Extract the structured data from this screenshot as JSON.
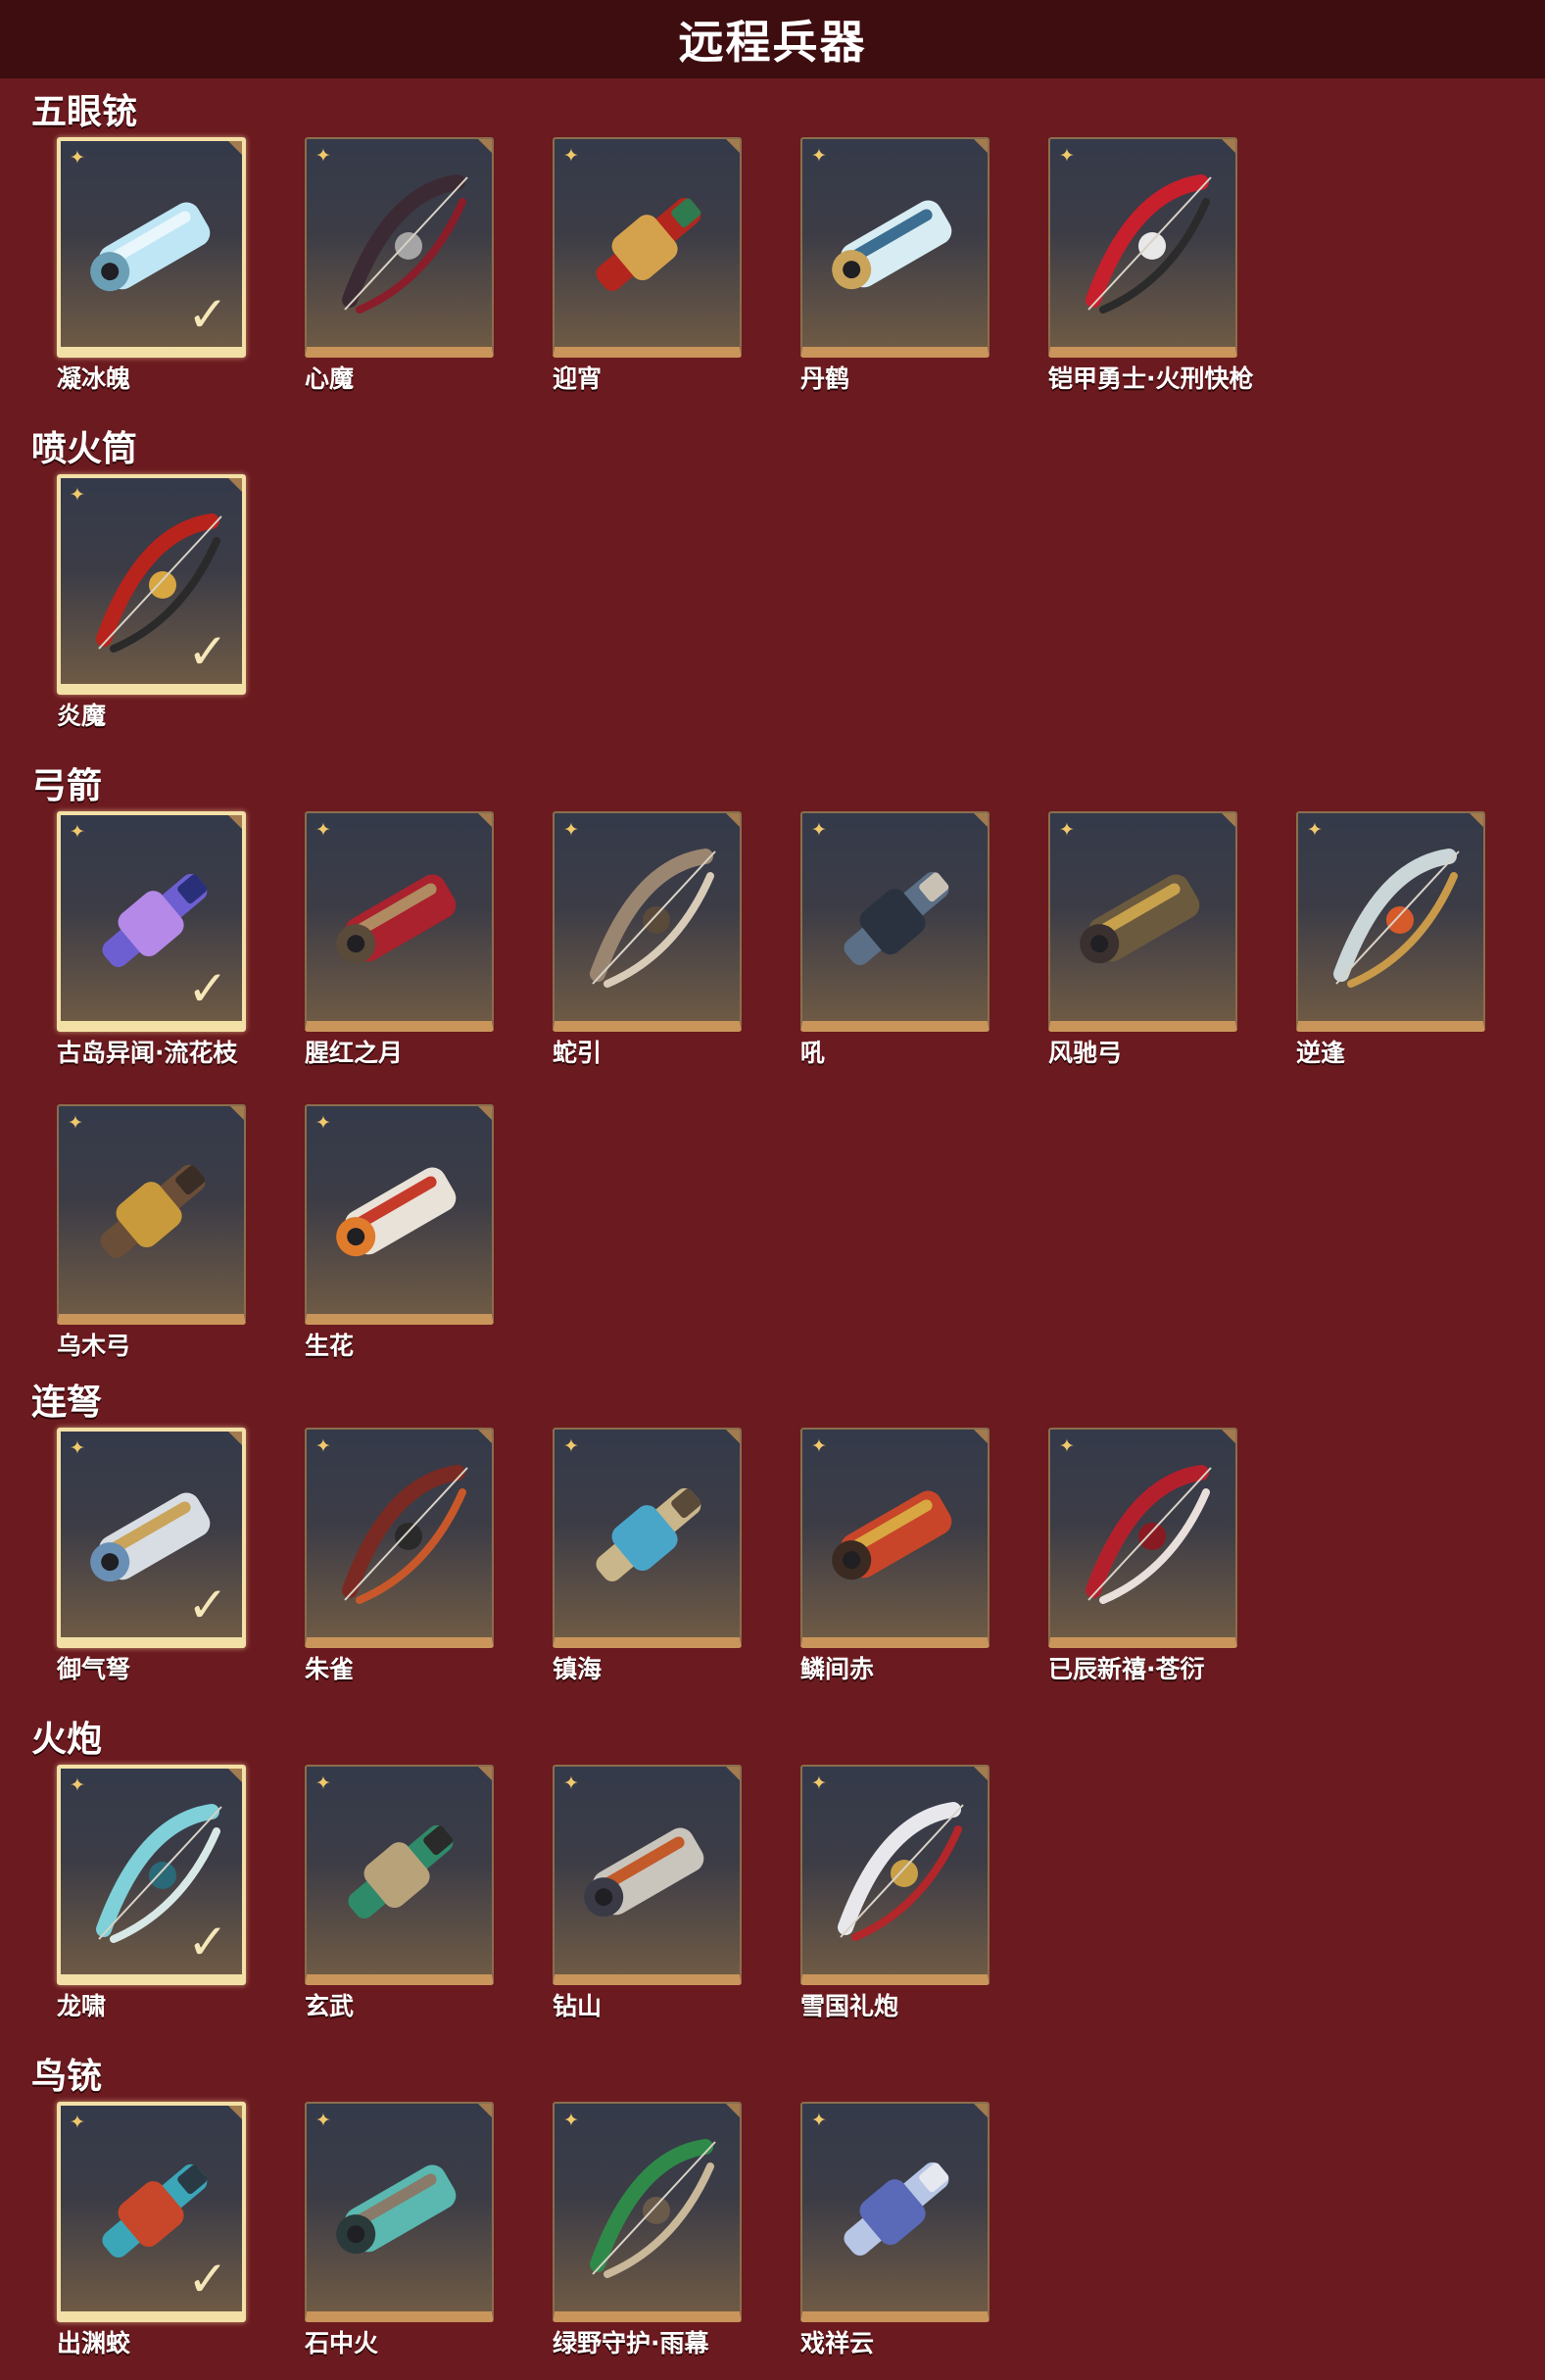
{
  "page_title": "远程兵器",
  "sections": [
    {
      "title": "五眼铳",
      "items": [
        {
          "name": "凝冰魄",
          "selected": true,
          "icon": "ice-five-barrel-gun-icon"
        },
        {
          "name": "心魔",
          "selected": false,
          "icon": "dark-demon-gun-icon"
        },
        {
          "name": "迎宵",
          "selected": false,
          "icon": "red-lion-gun-icon"
        },
        {
          "name": "丹鹤",
          "selected": false,
          "icon": "crane-gun-icon"
        },
        {
          "name": "铠甲勇士·火刑快枪",
          "selected": false,
          "icon": "armor-hero-gun-icon"
        }
      ]
    },
    {
      "title": "喷火筒",
      "items": [
        {
          "name": "炎魔",
          "selected": true,
          "icon": "flame-demon-tube-icon"
        }
      ]
    },
    {
      "title": "弓箭",
      "items": [
        {
          "name": "古岛异闻·流花枝",
          "selected": true,
          "icon": "purple-bow-icon"
        },
        {
          "name": "腥红之月",
          "selected": false,
          "icon": "crimson-moon-bow-icon"
        },
        {
          "name": "蛇引",
          "selected": false,
          "icon": "snake-bow-icon"
        },
        {
          "name": "吼",
          "selected": false,
          "icon": "roar-bow-icon"
        },
        {
          "name": "风驰弓",
          "selected": false,
          "icon": "wind-bow-icon"
        },
        {
          "name": "逆逢",
          "selected": false,
          "icon": "reverse-bow-icon"
        },
        {
          "name": "乌木弓",
          "selected": false,
          "icon": "ebony-bow-icon"
        },
        {
          "name": "生花",
          "selected": false,
          "icon": "blossom-bow-icon"
        }
      ]
    },
    {
      "title": "连弩",
      "items": [
        {
          "name": "御气弩",
          "selected": true,
          "icon": "qi-crossbow-icon"
        },
        {
          "name": "朱雀",
          "selected": false,
          "icon": "vermilion-bird-crossbow-icon"
        },
        {
          "name": "镇海",
          "selected": false,
          "icon": "sea-crossbow-icon"
        },
        {
          "name": "鳞间赤",
          "selected": false,
          "icon": "koi-crossbow-icon"
        },
        {
          "name": "已辰新禧·苍衍",
          "selected": false,
          "icon": "new-year-crossbow-icon"
        }
      ]
    },
    {
      "title": "火炮",
      "items": [
        {
          "name": "龙啸",
          "selected": true,
          "icon": "dragon-cannon-icon"
        },
        {
          "name": "玄武",
          "selected": false,
          "icon": "tortoise-cannon-icon"
        },
        {
          "name": "钻山",
          "selected": false,
          "icon": "drill-cannon-icon"
        },
        {
          "name": "雪国礼炮",
          "selected": false,
          "icon": "snow-salute-cannon-icon"
        }
      ]
    },
    {
      "title": "鸟铳",
      "items": [
        {
          "name": "出渊蛟",
          "selected": true,
          "icon": "abyss-dragon-musket-icon"
        },
        {
          "name": "石中火",
          "selected": false,
          "icon": "stone-fire-musket-icon"
        },
        {
          "name": "绿野守护·雨幕",
          "selected": false,
          "icon": "green-guardian-musket-icon"
        },
        {
          "name": "戏祥云",
          "selected": false,
          "icon": "cloud-musket-icon"
        }
      ]
    }
  ],
  "badge_glyph": "✦",
  "check_glyph": "✓",
  "colors": {
    "background": "#6b1a1f",
    "header": "#3d0d10",
    "tile_border": "#c9955a",
    "selected_border": "#f3e0a6",
    "badge": "#f1c96c"
  }
}
